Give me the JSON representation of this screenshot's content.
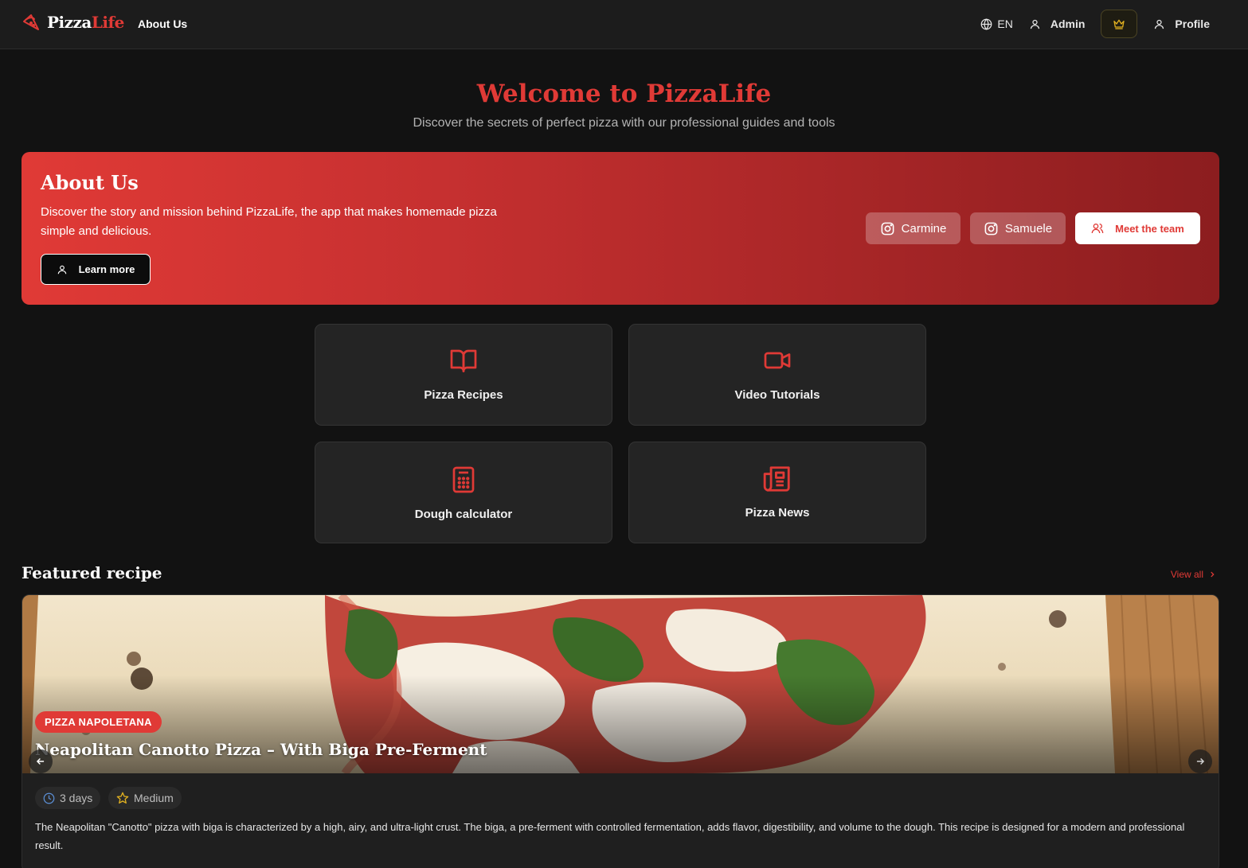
{
  "nav": {
    "logo_part1": "Pizza",
    "logo_part2": "Life",
    "about": "About Us",
    "language": "EN",
    "admin": "Admin",
    "profile": "Profile"
  },
  "hero": {
    "title": "Welcome to PizzaLife",
    "subtitle": "Discover the secrets of perfect pizza with our professional guides and tools"
  },
  "about": {
    "title": "About Us",
    "description": "Discover the story and mission behind PizzaLife, the app that makes homemade pizza simple and delicious.",
    "learn_more": "Learn more",
    "social1": "Carmine",
    "social2": "Samuele",
    "meet_team": "Meet the team"
  },
  "cards": [
    {
      "label": "Pizza Recipes",
      "icon": "book-open-icon"
    },
    {
      "label": "Video Tutorials",
      "icon": "video-icon"
    },
    {
      "label": "Dough calculator",
      "icon": "calculator-icon"
    },
    {
      "label": "Pizza News",
      "icon": "newspaper-icon"
    }
  ],
  "featured": {
    "section_title": "Featured recipe",
    "view_all": "View all",
    "badge": "PIZZA NAPOLETANA",
    "name": "Neapolitan Canotto Pizza – With Biga Pre-Ferment",
    "time": "3 days",
    "difficulty": "Medium",
    "description": "The Neapolitan \"Canotto\" pizza with biga is characterized by a high, airy, and ultra-light crust. The biga, a pre-ferment with controlled fermentation, adds flavor, digestibility, and volume to the dough. This recipe is designed for a modern and professional result."
  },
  "colors": {
    "accent": "#e03a36",
    "background": "#121212",
    "card": "#242424",
    "gold": "#e0b020"
  }
}
